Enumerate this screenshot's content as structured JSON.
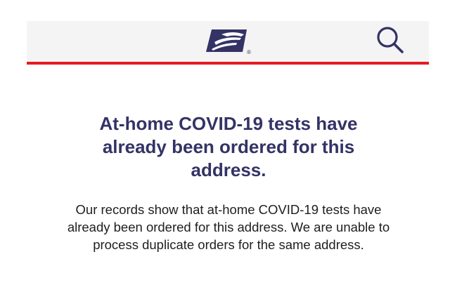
{
  "header": {
    "logo_icon": "usps-eagle-logo-icon",
    "registered_mark": "®",
    "search_icon": "search-icon"
  },
  "message": {
    "title": "At-home COVID-19 tests have already been ordered for this address.",
    "body": "Our records show that at-home COVID-19 tests have already been ordered for this address. We are unable to process duplicate orders for the same address."
  },
  "colors": {
    "header_bg": "#f4f4f4",
    "accent_red": "#e31c23",
    "brand_navy": "#333366",
    "body_text": "#1e1e1e"
  }
}
